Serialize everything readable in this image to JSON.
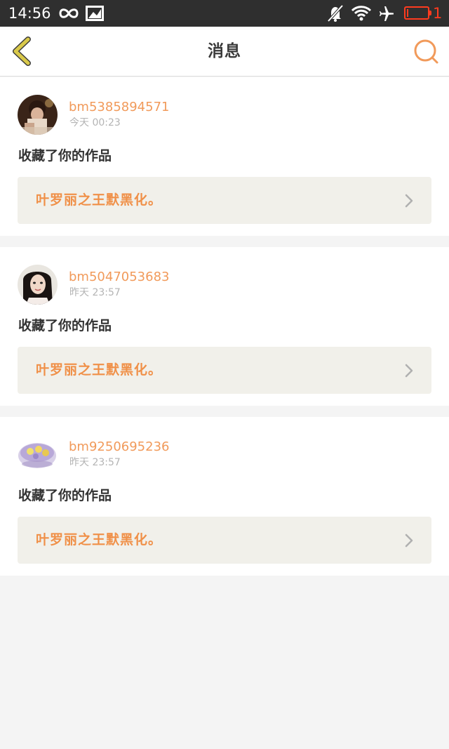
{
  "status_bar": {
    "time": "14:56",
    "battery_text": "1",
    "battery_level": 0.05,
    "battery_color": "#ff3b1f",
    "icons": [
      "infinity-icon",
      "image-notification-icon",
      "bell-muted-icon",
      "wifi-icon",
      "airplane-mode-icon",
      "battery-icon"
    ]
  },
  "nav": {
    "title": "消息",
    "back_icon": "chevron-left-icon",
    "search_icon": "search-icon"
  },
  "colors": {
    "accent": "#f19a5a",
    "work_title": "#f09048",
    "back_arrow": "#d9c94a",
    "card_bg": "#ffffff",
    "work_bg": "#f1f0ea",
    "page_bg": "#f4f4f4"
  },
  "messages": [
    {
      "username": "bm5385894571",
      "time": "今天 00:23",
      "action": "收藏了你的作品",
      "work_title": "叶罗丽之王默黑化。"
    },
    {
      "username": "bm5047053683",
      "time": "昨天 23:57",
      "action": "收藏了你的作品",
      "work_title": "叶罗丽之王默黑化。"
    },
    {
      "username": "bm9250695236",
      "time": "昨天 23:57",
      "action": "收藏了你的作品",
      "work_title": "叶罗丽之王默黑化。"
    }
  ]
}
